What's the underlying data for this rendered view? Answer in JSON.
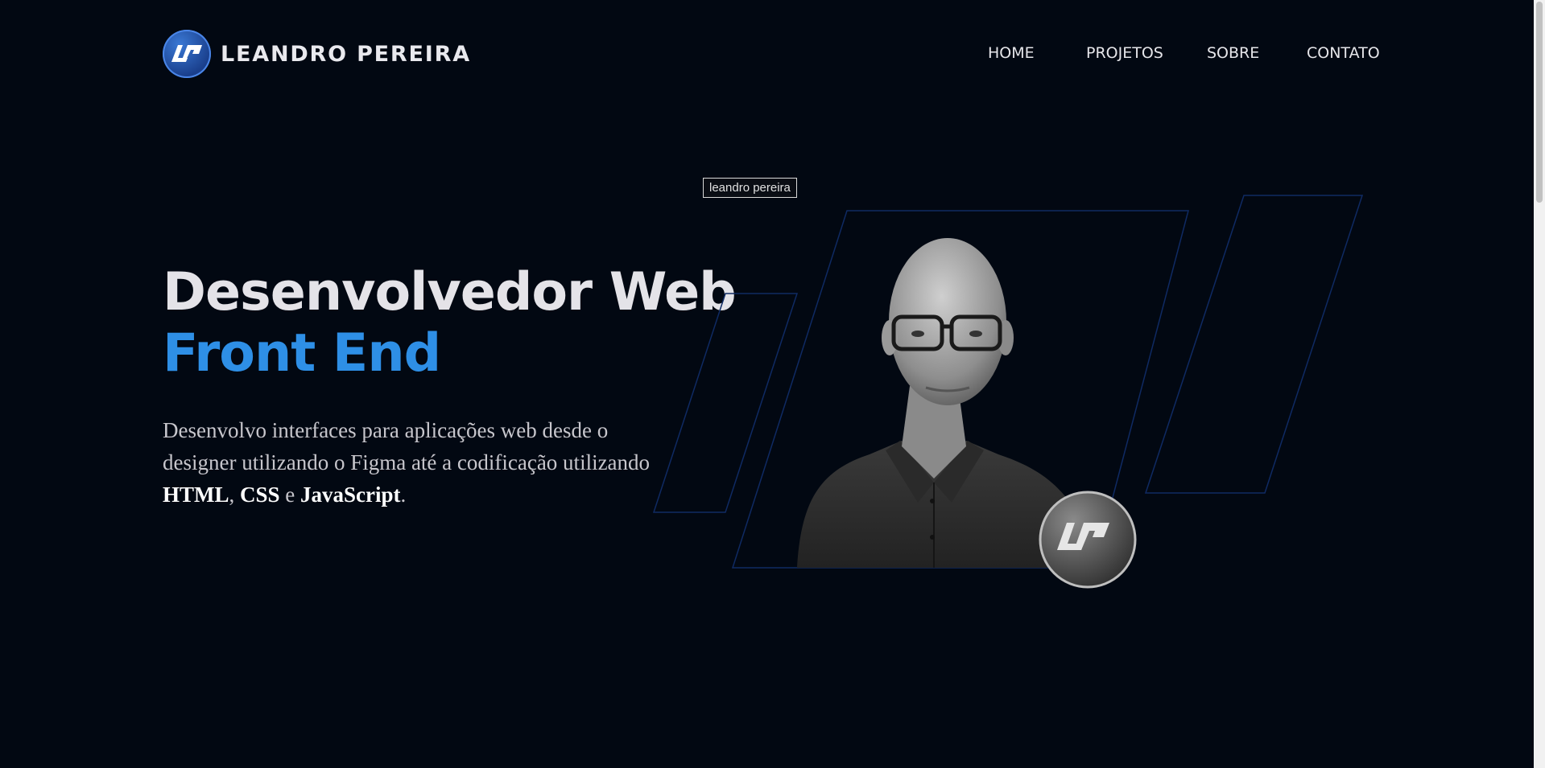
{
  "header": {
    "logo_name": "LEANDRO PEREIRA",
    "logo_mark": "LP",
    "nav": [
      "HOME",
      "PROJETOS",
      "SOBRE",
      "CONTATO"
    ]
  },
  "hero": {
    "title_line1": "Desenvolvedor Web",
    "title_line2": "Front End",
    "desc_part1": "Desenvolvo interfaces para aplicações web desde o designer utilizando o Figma até a codificação utilizando ",
    "desc_html": "HTML",
    "desc_sep1": ", ",
    "desc_css": "CSS",
    "desc_sep2": " e ",
    "desc_js": "JavaScript",
    "desc_end": "."
  },
  "photo": {
    "alt_tag": "leandro pereira"
  },
  "colors": {
    "background": "#020812",
    "accent": "#2e8fe6",
    "frame_stroke": "#0f2a63"
  }
}
